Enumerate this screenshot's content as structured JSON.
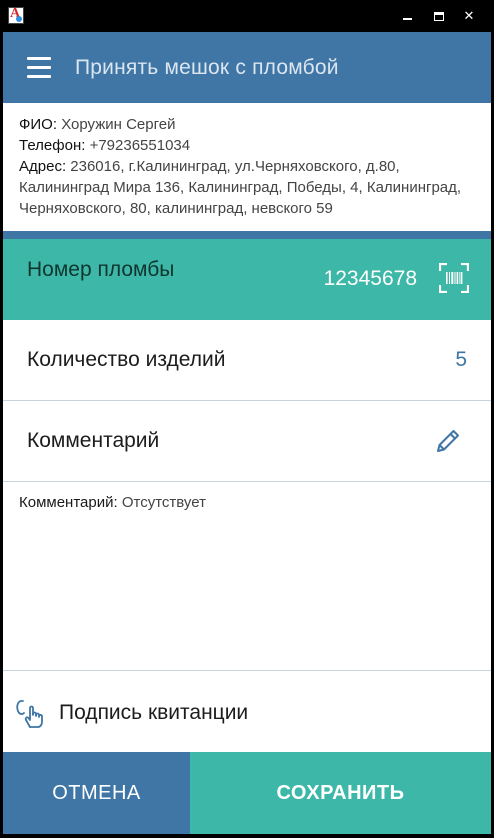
{
  "window": {
    "close_glyph": "✕"
  },
  "header": {
    "title": "Принять мешок с пломбой"
  },
  "client": {
    "name_label": "ФИО:",
    "name_value": "Хоружин Сергей",
    "phone_label": "Телефон:",
    "phone_value": "+79236551034",
    "address_label": "Адрес:",
    "address_value": "236016, г.Калининград, ул.Черняховского, д.80, Калининград Мира 136, Калининград, Победы, 4, Калининград, Черняховского, 80, калининград, невского 59"
  },
  "seal": {
    "label": "Номер пломбы",
    "value": "12345678",
    "icon": "barcode-scan-icon"
  },
  "quantity": {
    "label": "Количество изделий",
    "value": "5"
  },
  "comment": {
    "label": "Комментарий",
    "icon": "pencil-icon",
    "text_label": "Комментарий:",
    "text_value": "Отсутствует"
  },
  "signature": {
    "label": "Подпись квитанции",
    "icon": "hand-signature-icon"
  },
  "actions": {
    "cancel_label": "ОТМЕНА",
    "save_label": "СОХРАНИТЬ"
  },
  "colors": {
    "primary": "#3f76a5",
    "accent": "#3db8a8"
  }
}
